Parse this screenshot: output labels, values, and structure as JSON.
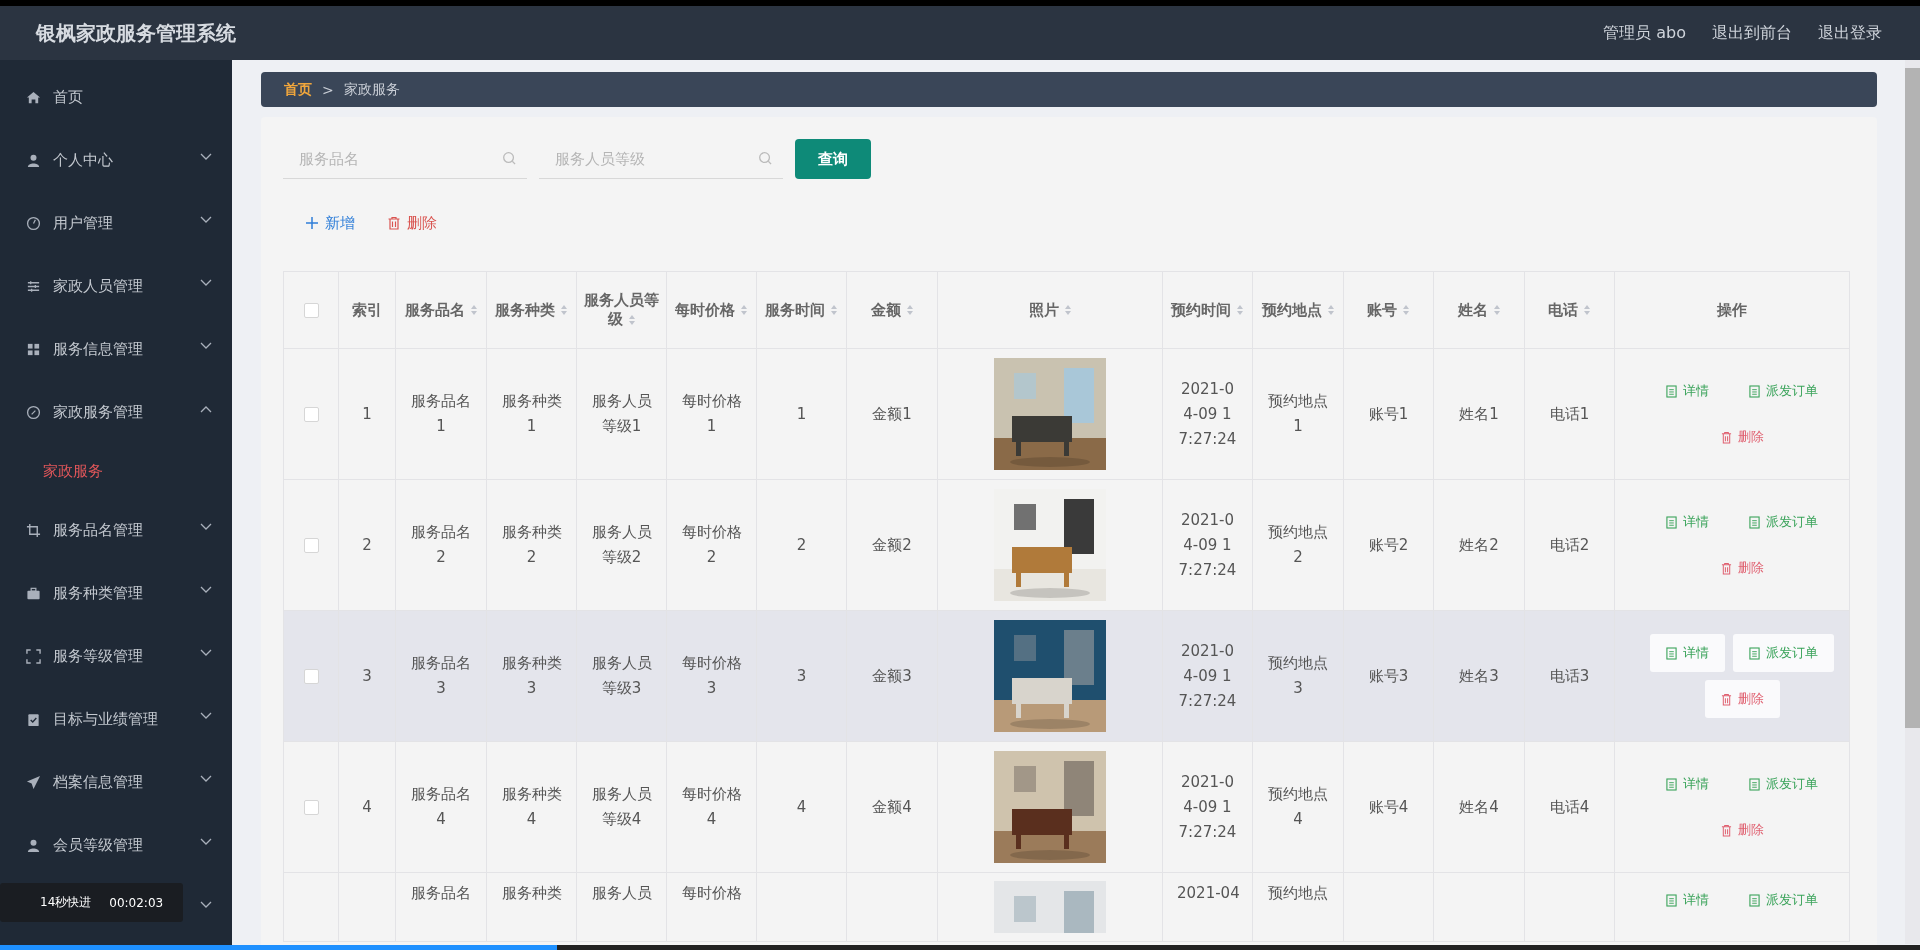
{
  "header": {
    "title": "银枫家政服务管理系统",
    "links": [
      "管理员 abo",
      "退出到前台",
      "退出登录"
    ]
  },
  "sidebar": {
    "items": [
      {
        "label": "首页"
      },
      {
        "label": "个人中心",
        "expanded": false
      },
      {
        "label": "用户管理",
        "expanded": false
      },
      {
        "label": "家政人员管理",
        "expanded": false
      },
      {
        "label": "服务信息管理",
        "expanded": false
      },
      {
        "label": "家政服务管理",
        "expanded": true,
        "children": [
          {
            "label": "家政服务",
            "selected": true
          }
        ]
      },
      {
        "label": "服务品名管理",
        "expanded": false
      },
      {
        "label": "服务种类管理",
        "expanded": false
      },
      {
        "label": "服务等级管理",
        "expanded": false
      },
      {
        "label": "目标与业绩管理",
        "expanded": false
      },
      {
        "label": "档案信息管理",
        "expanded": false
      },
      {
        "label": "会员等级管理",
        "expanded": false
      }
    ]
  },
  "breadcrumb": [
    "首页",
    ">",
    "家政服务"
  ],
  "search": {
    "fields": [
      {
        "placeholder": "服务品名"
      },
      {
        "placeholder": "服务人员等级"
      }
    ],
    "button": "查询"
  },
  "toolbar": {
    "add": "新增",
    "delete": "删除"
  },
  "table": {
    "select_all": {
      "checked": false
    },
    "columns": [
      {
        "label": "索引",
        "sortable": false
      },
      {
        "label": "服务品名",
        "sortable": true
      },
      {
        "label": "服务种类",
        "sortable": true
      },
      {
        "label": "服务人员等级",
        "sortable": true
      },
      {
        "label": "每时价格",
        "sortable": true
      },
      {
        "label": "服务时间",
        "sortable": true
      },
      {
        "label": "金额",
        "sortable": true
      },
      {
        "label": "照片",
        "sortable": true
      },
      {
        "label": "预约时间",
        "sortable": true
      },
      {
        "label": "预约地点",
        "sortable": true
      },
      {
        "label": "账号",
        "sortable": true
      },
      {
        "label": "姓名",
        "sortable": true
      },
      {
        "label": "电话",
        "sortable": true
      },
      {
        "label": "操作",
        "sortable": false
      }
    ],
    "rows": [
      {
        "selected": false,
        "hovered": false,
        "cells": [
          "1",
          "服务品名1",
          "服务种类1",
          "服务人员等级1",
          "每时价格1",
          "1",
          "金额1",
          {
            "kind": "picture"
          },
          "2021-04-09 17:27:24",
          "预约地点1",
          "账号1",
          "姓名1",
          "电话1"
        ],
        "actions": [
          {
            "label": "详情",
            "kind": "detail"
          },
          {
            "label": "派发订单",
            "kind": "dispatch"
          },
          {
            "label": "删除",
            "kind": "delete"
          }
        ]
      },
      {
        "selected": false,
        "hovered": false,
        "cells": [
          "2",
          "服务品名2",
          "服务种类2",
          "服务人员等级2",
          "每时价格2",
          "2",
          "金额2",
          {
            "kind": "picture"
          },
          "2021-04-09 17:27:24",
          "预约地点2",
          "账号2",
          "姓名2",
          "电话2"
        ],
        "actions": [
          {
            "label": "详情",
            "kind": "detail"
          },
          {
            "label": "派发订单",
            "kind": "dispatch"
          },
          {
            "label": "删除",
            "kind": "delete"
          }
        ]
      },
      {
        "selected": false,
        "hovered": true,
        "cells": [
          "3",
          "服务品名3",
          "服务种类3",
          "服务人员等级3",
          "每时价格3",
          "3",
          "金额3",
          {
            "kind": "picture"
          },
          "2021-04-09 17:27:24",
          "预约地点3",
          "账号3",
          "姓名3",
          "电话3"
        ],
        "actions": [
          {
            "label": "详情",
            "kind": "detail"
          },
          {
            "label": "派发订单",
            "kind": "dispatch"
          },
          {
            "label": "删除",
            "kind": "delete"
          }
        ]
      },
      {
        "selected": false,
        "hovered": false,
        "cells": [
          "4",
          "服务品名4",
          "服务种类4",
          "服务人员等级4",
          "每时价格4",
          "4",
          "金额4",
          {
            "kind": "picture"
          },
          "2021-04-09 17:27:24",
          "预约地点4",
          "账号4",
          "姓名4",
          "电话4"
        ],
        "actions": [
          {
            "label": "详情",
            "kind": "detail"
          },
          {
            "label": "派发订单",
            "kind": "dispatch"
          },
          {
            "label": "删除",
            "kind": "delete"
          }
        ]
      },
      {
        "hovered": false,
        "cells": [
          null,
          "服务品名",
          "服务种类",
          "服务人员",
          "每时价格",
          null,
          null,
          {
            "kind": "picture"
          },
          "2021-04",
          "预约地点",
          null,
          null,
          null
        ],
        "actions": [
          {
            "label": "详情",
            "kind": "detail"
          },
          {
            "label": "派发订单",
            "kind": "dispatch"
          }
        ]
      }
    ]
  },
  "video_overlay": {
    "label": "14秒快进",
    "time": "00:02:03",
    "progress": {
      "level": 0.29
    }
  }
}
